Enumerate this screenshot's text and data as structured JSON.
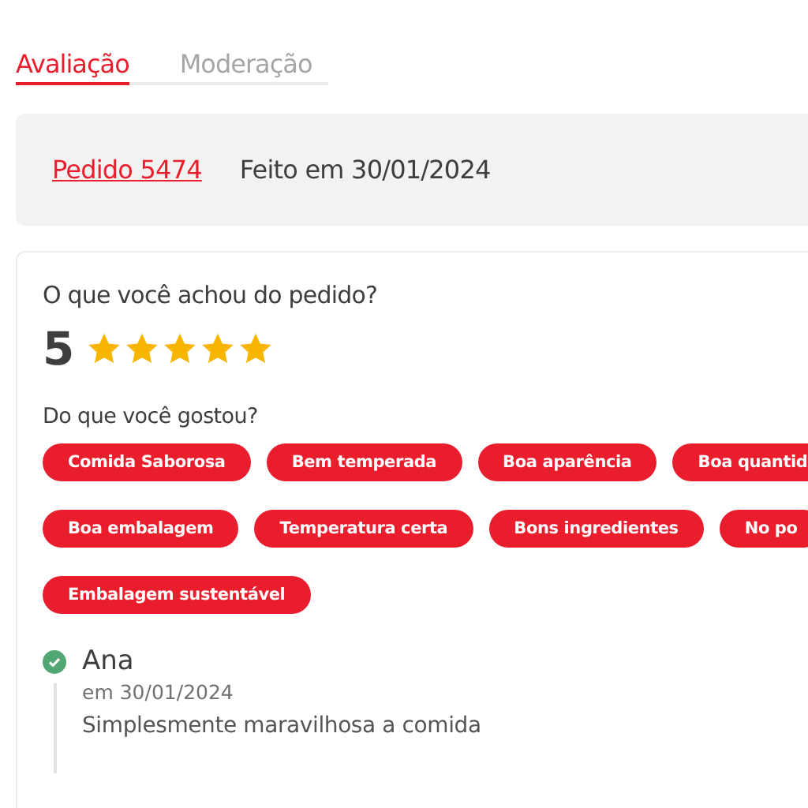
{
  "tabs": [
    {
      "label": "Avaliação",
      "selected": true
    },
    {
      "label": "Moderação",
      "selected": false
    }
  ],
  "order": {
    "link": "Pedido 5474",
    "date": "Feito em 30/01/2024"
  },
  "rating": {
    "question": "O que você achou do pedido?",
    "score": "5",
    "stars": 5
  },
  "likes": {
    "question": "Do que você gostou?",
    "tag_rows": [
      [
        "Comida Saborosa",
        "Bem temperada",
        "Boa aparência",
        "Boa quantid"
      ],
      [
        "Boa embalagem",
        "Temperatura certa",
        "Bons ingredientes",
        "No po"
      ],
      [
        "Embalagem sustentável"
      ]
    ]
  },
  "comments": [
    {
      "author": "Ana",
      "verified": true,
      "date": "em 30/01/2024",
      "text": "Simplesmente maravilhosa a comida"
    }
  ]
}
